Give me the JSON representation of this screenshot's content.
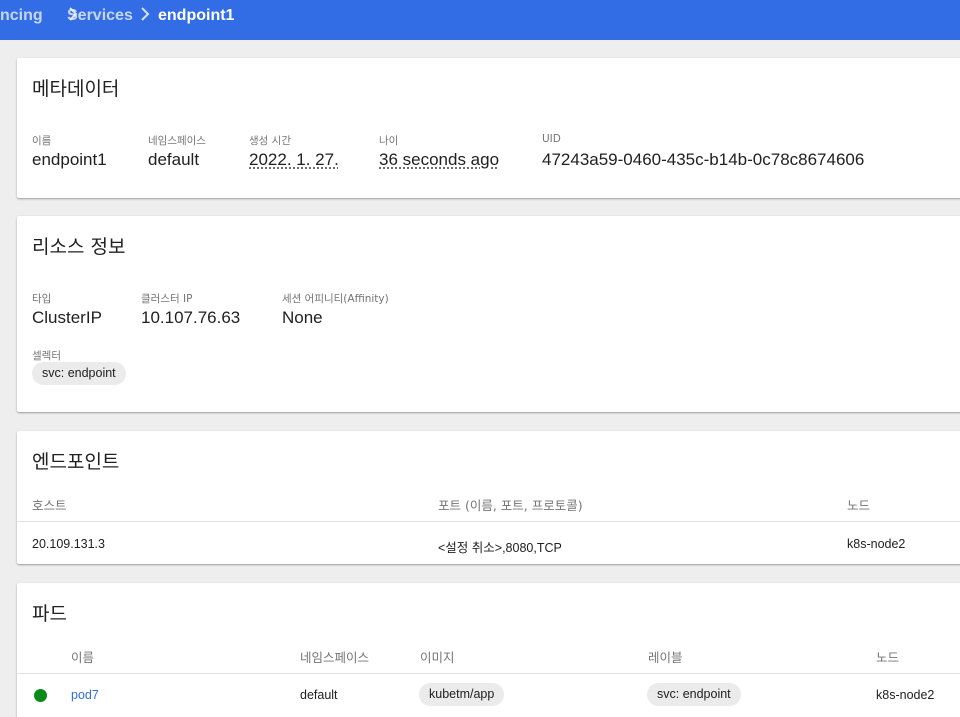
{
  "breadcrumb": {
    "items": [
      "ncing",
      "Services"
    ],
    "current": "endpoint1"
  },
  "metadata": {
    "title": "메타데이터",
    "fields": {
      "name": {
        "label": "이름",
        "value": "endpoint1"
      },
      "namespace": {
        "label": "네임스페이스",
        "value": "default"
      },
      "created": {
        "label": "생성 시간",
        "value": "2022. 1. 27."
      },
      "age": {
        "label": "나이",
        "value": "36 seconds ago"
      },
      "uid": {
        "label": "UID",
        "value": "47243a59-0460-435c-b14b-0c78c8674606"
      }
    }
  },
  "resource": {
    "title": "리소스 정보",
    "type": {
      "label": "타입",
      "value": "ClusterIP"
    },
    "cluster_ip": {
      "label": "클러스터 IP",
      "value": "10.107.76.63"
    },
    "affinity": {
      "label": "세션 어피니티(Affinity)",
      "value": "None"
    },
    "selector": {
      "label": "셀렉터",
      "chip": "svc: endpoint"
    }
  },
  "endpoints": {
    "title": "엔드포인트",
    "headers": {
      "host": "호스트",
      "ports": "포트 (이름, 포트, 프로토콜)",
      "node": "노드"
    },
    "rows": [
      {
        "host": "20.109.131.3",
        "ports": "<설정 취소>,8080,TCP",
        "node": "k8s-node2"
      }
    ]
  },
  "pods": {
    "title": "파드",
    "headers": {
      "name": "이름",
      "namespace": "네임스페이스",
      "image": "이미지",
      "labels": "레이블",
      "node": "노드"
    },
    "rows": [
      {
        "status": "running",
        "name": "pod7",
        "namespace": "default",
        "image": "kubetm/app",
        "label": "svc: endpoint",
        "node": "k8s-node2"
      }
    ]
  },
  "colors": {
    "topbar": "#326de6",
    "link": "#326de6",
    "status_running": "#0a8a1a"
  }
}
